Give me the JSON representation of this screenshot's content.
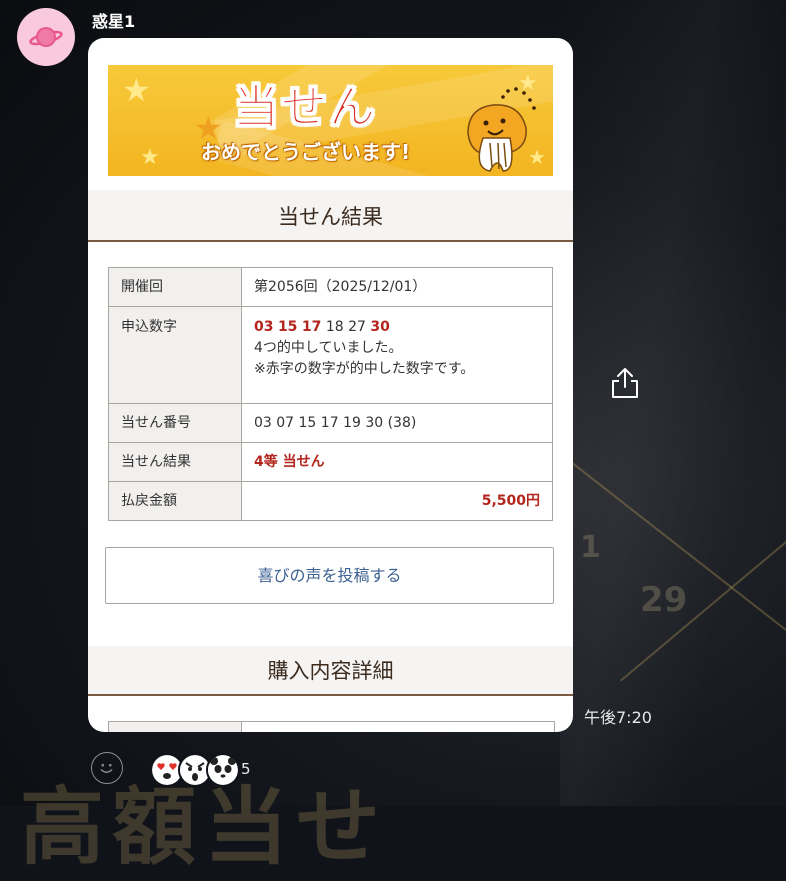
{
  "sender": {
    "name": "惑星1"
  },
  "banner": {
    "title": "当せん",
    "subtitle": "おめでとうございます!"
  },
  "result_section": {
    "heading": "当せん結果",
    "rows": [
      {
        "label": "開催回",
        "value": "第2056回（2025/12/01）"
      },
      {
        "label": "申込数字",
        "numbers": [
          {
            "n": "03",
            "hit": true
          },
          {
            "n": "15",
            "hit": true
          },
          {
            "n": "17",
            "hit": true
          },
          {
            "n": "18",
            "hit": false
          },
          {
            "n": "27",
            "hit": false
          },
          {
            "n": "30",
            "hit": true
          }
        ],
        "line2": "4つ的中していました。",
        "line3": "※赤字の数字が的中した数字です。"
      },
      {
        "label": "当せん番号",
        "value": "03 07 15 17 19 30 (38)"
      },
      {
        "label": "当せん結果",
        "value": "4等 当せん"
      },
      {
        "label": "払戻金額",
        "value": "5,500円"
      }
    ]
  },
  "voice_button": {
    "label": "喜びの声を投稿する"
  },
  "purchase_section": {
    "heading": "購入内容詳細"
  },
  "message_meta": {
    "time": "午後7:20",
    "reaction_count": "5"
  },
  "colors": {
    "hit_red": "#b3261e",
    "link_blue": "#3c6192",
    "banner_yellow": "#f5bd2a",
    "section_rule": "#7a5a40"
  }
}
